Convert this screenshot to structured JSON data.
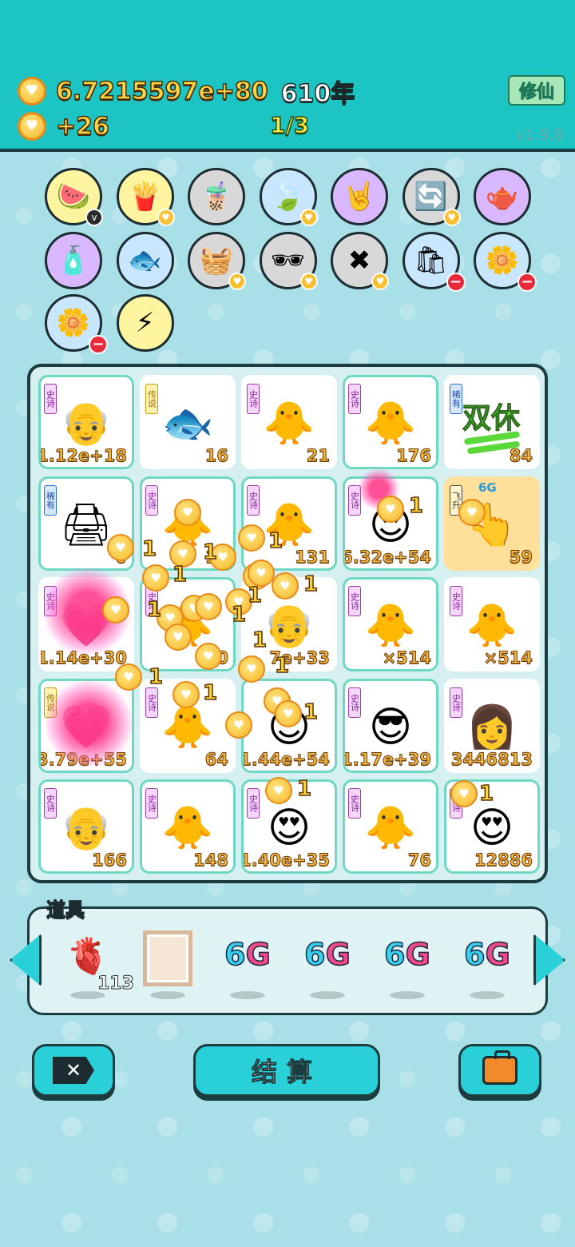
{
  "header": {
    "currency_total": "6.7215597e+80",
    "years": "610年",
    "income_rate": "+26",
    "progress": "1/3",
    "cultivate_button": "修仙",
    "version": "v1.9.8"
  },
  "item_circles": [
    {
      "icon": "fruit-basket-icon",
      "glyph": "🍉",
      "bg": "#fff5a0",
      "badge": "v"
    },
    {
      "icon": "fries-icon",
      "glyph": "🍟",
      "bg": "#fff5a0",
      "badge": "coin"
    },
    {
      "icon": "milk-tea-icon",
      "glyph": "🧋",
      "bg": "#d8d8d8",
      "badge": ""
    },
    {
      "icon": "leaf-icon",
      "glyph": "🍃",
      "bg": "#c9e6ff",
      "badge": "coin"
    },
    {
      "icon": "rock-hand-icon",
      "glyph": "🤘",
      "bg": "#d9b8ff",
      "badge": ""
    },
    {
      "icon": "refresh-icon",
      "glyph": "🔄",
      "bg": "#d8d8d8",
      "badge": "coin"
    },
    {
      "icon": "gravy-boat-icon",
      "glyph": "🫖",
      "bg": "#d9b8ff",
      "badge": ""
    },
    {
      "icon": "spray-bottle-icon",
      "glyph": "🧴",
      "bg": "#d9b8ff",
      "badge": ""
    },
    {
      "icon": "fish-tank-icon",
      "glyph": "🐟",
      "bg": "#c9e6ff",
      "badge": ""
    },
    {
      "icon": "fruit-basket-2-icon",
      "glyph": "🧺",
      "bg": "#d8d8d8",
      "badge": "coin"
    },
    {
      "icon": "sunglasses-icon",
      "glyph": "🕶",
      "bg": "#d8d8d8",
      "badge": "coin"
    },
    {
      "icon": "close-tag-icon",
      "glyph": "✖",
      "bg": "#d8d8d8",
      "badge": "coin"
    },
    {
      "icon": "sack-icon",
      "glyph": "🛍",
      "bg": "#c9e6ff",
      "badge": "minus"
    },
    {
      "icon": "flower-pot-icon",
      "glyph": "🌼",
      "bg": "#c9e6ff",
      "badge": "minus"
    },
    {
      "icon": "flower-pot-2-icon",
      "glyph": "🌼",
      "bg": "#c9e6ff",
      "badge": "minus"
    },
    {
      "icon": "lightning-icon",
      "glyph": "⚡",
      "bg": "#fff5a0",
      "badge": ""
    }
  ],
  "grid": [
    [
      {
        "tag": "史诗",
        "tag_type": "epic",
        "glyph": "👴",
        "value": "1.12e+18"
      },
      {
        "tag": "传说",
        "tag_type": "legend",
        "glyph": "🐟",
        "value": "16",
        "plain": true
      },
      {
        "tag": "史诗",
        "tag_type": "epic",
        "glyph": "🐥",
        "value": "21",
        "plain": true
      },
      {
        "tag": "史诗",
        "tag_type": "epic",
        "glyph": "🐥",
        "value": "176"
      },
      {
        "tag": "稀有",
        "tag_type": "rare",
        "glyph": "",
        "value": "84",
        "plain": true,
        "special": "双休"
      }
    ],
    [
      {
        "tag": "稀有",
        "tag_type": "rare",
        "glyph": "🖨",
        "value": "0"
      },
      {
        "tag": "史诗",
        "tag_type": "epic",
        "glyph": "🐥",
        "value": "10"
      },
      {
        "tag": "史诗",
        "tag_type": "epic",
        "glyph": "🐥",
        "value": "131"
      },
      {
        "tag": "史诗",
        "tag_type": "epic",
        "glyph": "😍",
        "value": "6.32e+54"
      },
      {
        "tag": "飞升",
        "tag_type": "fly",
        "glyph": "👆",
        "value": "59",
        "gold": true,
        "badge": "6G"
      }
    ],
    [
      {
        "tag": "史诗",
        "tag_type": "epic",
        "glyph": "💗",
        "value": "1.14e+30",
        "plain": true
      },
      {
        "tag": "史诗",
        "tag_type": "epic",
        "glyph": "🐥",
        "value": "20"
      },
      {
        "tag": "",
        "tag_type": "epic",
        "glyph": "👴",
        "value": "7e+33",
        "plain": true
      },
      {
        "tag": "史诗",
        "tag_type": "epic",
        "glyph": "🐥",
        "value": "×514"
      },
      {
        "tag": "史诗",
        "tag_type": "epic",
        "glyph": "🐥",
        "value": "×514",
        "plain": true
      }
    ],
    [
      {
        "tag": "传说",
        "tag_type": "legend",
        "glyph": "💗",
        "value": "3.79e+55"
      },
      {
        "tag": "史诗",
        "tag_type": "epic",
        "glyph": "🐥",
        "value": "64",
        "plain": true
      },
      {
        "tag": "",
        "tag_type": "epic",
        "glyph": "😍",
        "value": "1.44e+54"
      },
      {
        "tag": "史诗",
        "tag_type": "epic",
        "glyph": "😎",
        "value": "1.17e+39"
      },
      {
        "tag": "史诗",
        "tag_type": "epic",
        "glyph": "👩",
        "value": "3446813",
        "plain": true
      }
    ],
    [
      {
        "tag": "史诗",
        "tag_type": "epic",
        "glyph": "👴",
        "value": "166"
      },
      {
        "tag": "史诗",
        "tag_type": "epic",
        "glyph": "🐥",
        "value": "148"
      },
      {
        "tag": "史诗",
        "tag_type": "epic",
        "glyph": "😍",
        "value": "1.40e+35"
      },
      {
        "tag": "史诗",
        "tag_type": "epic",
        "glyph": "🐥",
        "value": "76"
      },
      {
        "tag": "史诗",
        "tag_type": "epic",
        "glyph": "😍",
        "value": "12886"
      }
    ]
  ],
  "floating_number": "1",
  "props": {
    "label": "道具",
    "items": [
      {
        "icon": "liver-icon",
        "glyph": "🫀",
        "count": "113"
      },
      {
        "icon": "frame-icon",
        "glyph": "",
        "count": ""
      },
      {
        "icon": "6g-icon",
        "text": "6G"
      },
      {
        "icon": "6g-icon",
        "text": "6G"
      },
      {
        "icon": "6g-icon",
        "text": "6G"
      },
      {
        "icon": "6g-icon",
        "text": "6G"
      }
    ]
  },
  "buttons": {
    "cancel_icon": "close-tag-icon",
    "settle_label": "结算",
    "bag_icon": "briefcase-icon"
  }
}
